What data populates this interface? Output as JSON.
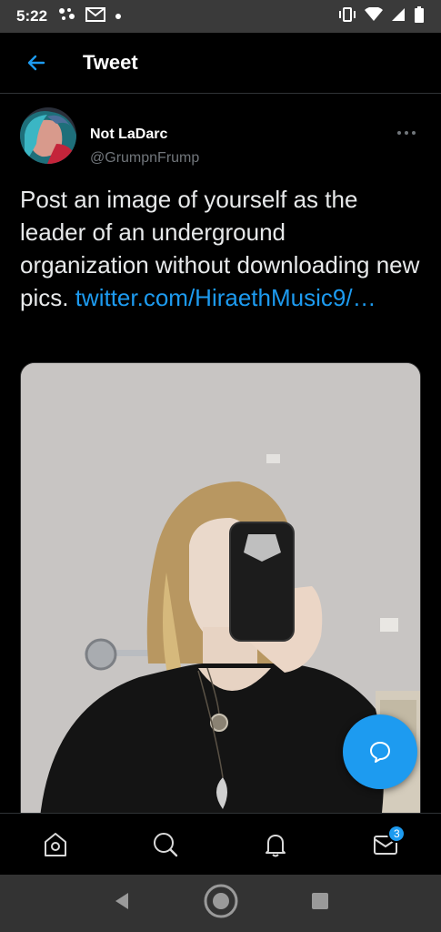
{
  "status_bar": {
    "time": "5:22"
  },
  "header": {
    "title": "Tweet"
  },
  "tweet": {
    "author": {
      "display_name": "Not LaDarc",
      "handle": "@GrumpnFrump"
    },
    "text": "Post an image of yourself as the leader of an underground organization without downloading new pics.",
    "link": "twitter.com/HiraethMusic9/…"
  },
  "nav": {
    "items": [
      "home-icon",
      "search-icon",
      "notifications-icon",
      "messages-icon"
    ],
    "messages_badge": "3"
  },
  "colors": {
    "accent": "#1d9bf0",
    "background": "#000000",
    "secondary_text": "#71767b"
  }
}
